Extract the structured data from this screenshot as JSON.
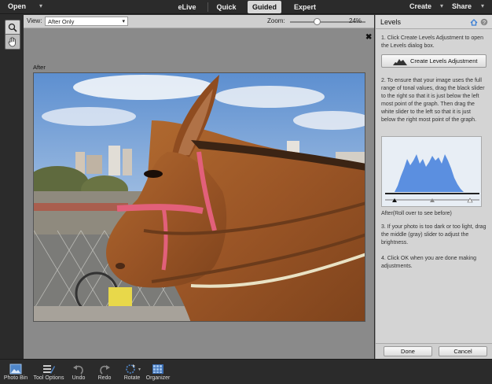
{
  "menubar": {
    "open_label": "Open",
    "modes": [
      "eLive",
      "Quick",
      "Guided",
      "Expert"
    ],
    "active_mode": "Guided",
    "create_label": "Create",
    "share_label": "Share"
  },
  "options": {
    "view_label": "View:",
    "view_value": "After Only",
    "zoom_label": "Zoom:",
    "zoom_value": "24%",
    "zoom_fraction": 0.24
  },
  "canvas": {
    "after_label": "After"
  },
  "panel": {
    "title": "Levels",
    "step1": "1. Click Create Levels Adjustment to open the Levels dialog box.",
    "create_button": "Create Levels Adjustment",
    "step2": "2. To ensure that your image uses the full range of tonal values, drag the black slider to the right so that it is just below the left most point of the graph. Then drag the white slider to the left so that it is just below the right most point of the graph.",
    "after_caption": "After(Roll over to see before)",
    "step3": "3. If your photo is too dark or too light, drag the middle (gray) slider to adjust the brightness.",
    "step4": "4. Click OK when you are done making adjustments.",
    "done_label": "Done",
    "cancel_label": "Cancel"
  },
  "bottombar": {
    "items": [
      "Photo Bin",
      "Tool Options",
      "Undo",
      "Redo",
      "Rotate",
      "Organizer"
    ]
  },
  "colors": {
    "accent_blue": "#3a7fd5",
    "histogram_blue": "#5b8fe0",
    "pink_halter": "#e2607a"
  },
  "icons": [
    "zoom-icon",
    "hand-icon",
    "close-icon",
    "help-icon",
    "home-icon",
    "photo-bin-icon",
    "tool-options-icon",
    "undo-icon",
    "redo-icon",
    "rotate-icon",
    "organizer-icon"
  ]
}
